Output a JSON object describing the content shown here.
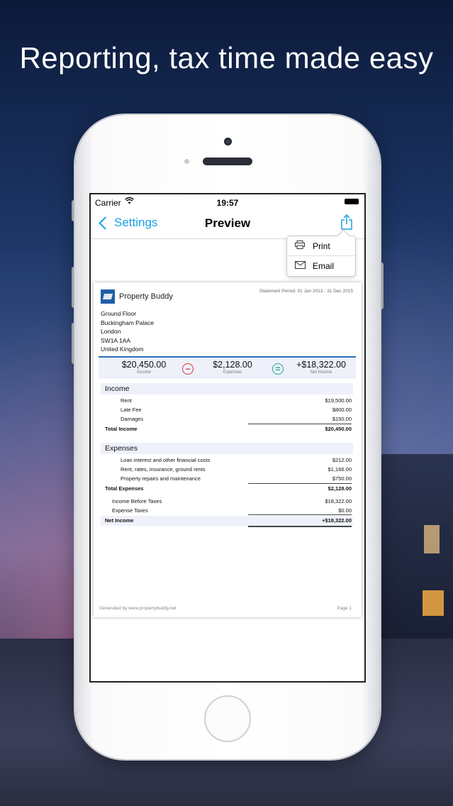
{
  "headline": "Reporting, tax time made easy",
  "status_bar": {
    "carrier": "Carrier",
    "time": "19:57"
  },
  "nav": {
    "back_label": "Settings",
    "title": "Preview"
  },
  "share_menu": {
    "items": [
      {
        "label": "Print",
        "icon": "printer-icon"
      },
      {
        "label": "Email",
        "icon": "envelope-icon"
      }
    ]
  },
  "report": {
    "brand": "Property Buddy",
    "period": "Statement Period: 01 Jan 2013 - 31 Dec 2015",
    "address": [
      "Ground Floor",
      "Buckingham Palace",
      "London",
      "SW1A 1AA",
      "United Kingdom"
    ],
    "summary": {
      "income": {
        "value": "$20,450.00",
        "label": "Income"
      },
      "expenses": {
        "value": "$2,128.00",
        "label": "Expenses"
      },
      "net": {
        "value": "+$18,322.00",
        "label": "Net Income"
      }
    },
    "income_section": {
      "title": "Income",
      "rows": [
        {
          "label": "Rent",
          "value": "$19,500.00"
        },
        {
          "label": "Late Fee",
          "value": "$800.00"
        },
        {
          "label": "Damages",
          "value": "$150.00"
        }
      ],
      "total": {
        "label": "Total Income",
        "value": "$20,450.00"
      }
    },
    "expenses_section": {
      "title": "Expenses",
      "rows": [
        {
          "label": "Loan interest and other financial costs",
          "value": "$212.00"
        },
        {
          "label": "Rent, rates, insurance, ground rents",
          "value": "$1,166.00"
        },
        {
          "label": "Property repairs and maintenance",
          "value": "$750.00"
        }
      ],
      "total": {
        "label": "Total Expenses",
        "value": "$2,128.00"
      }
    },
    "before_taxes": {
      "label": "Income Before Taxes",
      "value": "$18,322.00"
    },
    "taxes": {
      "label": "Expense Taxes",
      "value": "$0.00"
    },
    "net_income": {
      "label": "Net Income",
      "value": "+$18,322.00"
    },
    "footer": {
      "generated": "Generated by www.propertybuddy.net",
      "page": "Page 1"
    }
  },
  "colors": {
    "accent": "#1aa0e6",
    "minus": "#d9383c",
    "equal": "#1ea889",
    "summary_border": "#2c6fb3"
  }
}
